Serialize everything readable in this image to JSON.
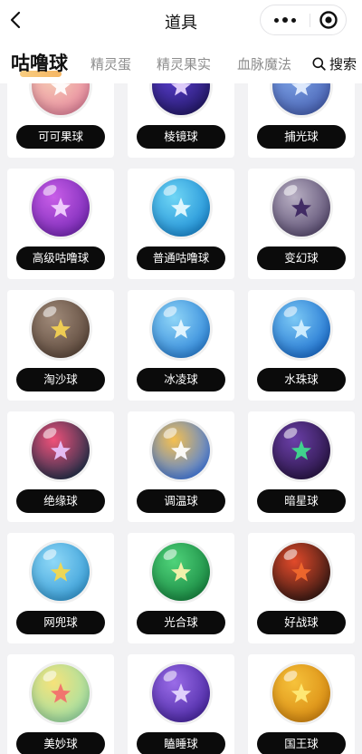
{
  "header": {
    "title": "道具"
  },
  "tabs": [
    {
      "label": "咕噜球",
      "active": true
    },
    {
      "label": "精灵蛋",
      "active": false
    },
    {
      "label": "精灵果实",
      "active": false
    },
    {
      "label": "血脉魔法",
      "active": false
    }
  ],
  "search": {
    "label": "搜索"
  },
  "items": [
    {
      "name": "可可果球",
      "icon": "cocoa-fruit-ball-icon",
      "colors": [
        "#f7d2b5",
        "#e88aa0"
      ],
      "core": "#ffffff"
    },
    {
      "name": "棱镜球",
      "icon": "prism-ball-icon",
      "colors": [
        "#5b3fd1",
        "#251a6b"
      ],
      "core": "#e9d7ff"
    },
    {
      "name": "捕光球",
      "icon": "light-catch-ball-icon",
      "colors": [
        "#7fa6e8",
        "#4a64b5"
      ],
      "core": "#e6f0ff"
    },
    {
      "name": "高级咕噜球",
      "icon": "premium-gulu-ball-icon",
      "colors": [
        "#c95ee8",
        "#7a2bb8"
      ],
      "core": "#f3d4ff"
    },
    {
      "name": "普通咕噜球",
      "icon": "normal-gulu-ball-icon",
      "colors": [
        "#6fd6f5",
        "#1f8fd6"
      ],
      "core": "#e9fbff"
    },
    {
      "name": "变幻球",
      "icon": "transform-ball-icon",
      "colors": [
        "#b9b0c4",
        "#5c4f73"
      ],
      "core": "#3a235e"
    },
    {
      "name": "淘沙球",
      "icon": "sand-panning-ball-icon",
      "colors": [
        "#a08a79",
        "#5e4a3d"
      ],
      "core": "#f6d452"
    },
    {
      "name": "冰凌球",
      "icon": "icicle-ball-icon",
      "colors": [
        "#8fd5f7",
        "#2f86d9"
      ],
      "core": "#eaf8ff"
    },
    {
      "name": "水珠球",
      "icon": "water-drop-ball-icon",
      "colors": [
        "#7cc9f5",
        "#1f72d0"
      ],
      "core": "#d6f1ff"
    },
    {
      "name": "绝缘球",
      "icon": "insulation-ball-icon",
      "colors": [
        "#f0517a",
        "#27304a"
      ],
      "core": "#e9c6ff"
    },
    {
      "name": "调温球",
      "icon": "temperature-ball-icon",
      "colors": [
        "#f5c04f",
        "#4a7fe0"
      ],
      "core": "#ffffff"
    },
    {
      "name": "暗星球",
      "icon": "dark-star-ball-icon",
      "colors": [
        "#6b3fa8",
        "#2a1647"
      ],
      "core": "#3fe08e"
    },
    {
      "name": "网兜球",
      "icon": "net-ball-icon",
      "colors": [
        "#8fd8f7",
        "#3a9fd8"
      ],
      "core": "#f7d84a"
    },
    {
      "name": "光合球",
      "icon": "photosynthesis-ball-icon",
      "colors": [
        "#4fd37a",
        "#1a8a43"
      ],
      "core": "#fff4b0"
    },
    {
      "name": "好战球",
      "icon": "warlike-ball-icon",
      "colors": [
        "#e24a2a",
        "#3b1a14"
      ],
      "core": "#f26a2e"
    },
    {
      "name": "美妙球",
      "icon": "wonderful-ball-icon",
      "colors": [
        "#f6e27a",
        "#9fe0a6"
      ],
      "core": "#f36b6b"
    },
    {
      "name": "瞌睡球",
      "icon": "sleepy-ball-icon",
      "colors": [
        "#9a6ce8",
        "#4d2aa6"
      ],
      "core": "#e8dbff"
    },
    {
      "name": "国王球",
      "icon": "king-ball-icon",
      "colors": [
        "#f6c23b",
        "#d98b12"
      ],
      "core": "#ffec7a"
    }
  ]
}
